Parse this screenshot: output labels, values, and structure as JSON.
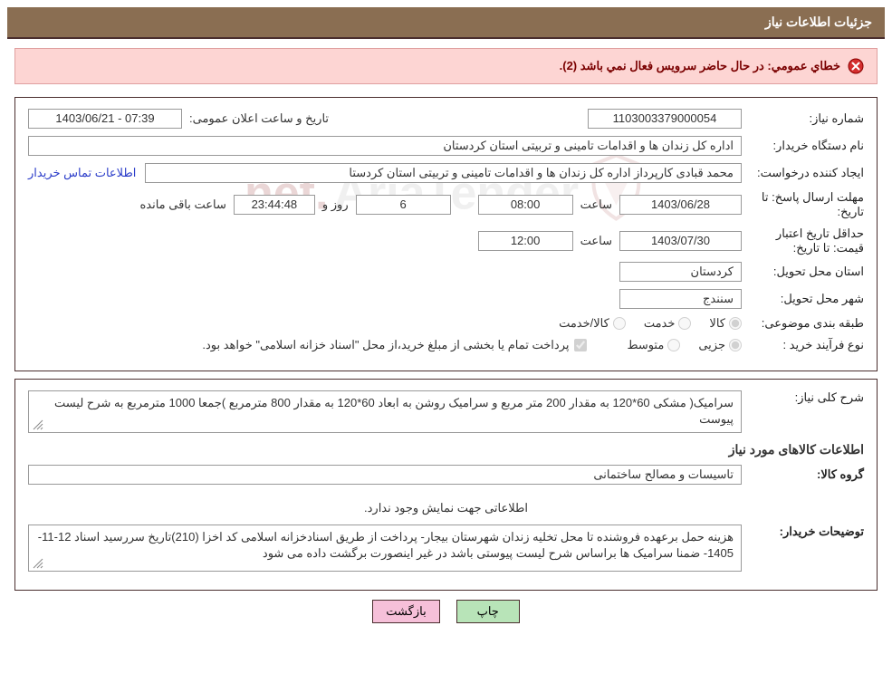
{
  "header": {
    "title": "جزئیات اطلاعات نیاز"
  },
  "error": {
    "message": "خطاي عمومي: در حال حاضر سرويس فعال نمي باشد (2)."
  },
  "fields": {
    "need_number_label": "شماره نیاز:",
    "need_number": "1103003379000054",
    "announce_datetime_label": "تاریخ و ساعت اعلان عمومی:",
    "announce_datetime": "1403/06/21 - 07:39",
    "buyer_org_label": "نام دستگاه خریدار:",
    "buyer_org": "اداره کل زندان ها و اقدامات تامینی و تربیتی استان کردستان",
    "requester_label": "ایجاد کننده درخواست:",
    "requester": "محمد  قبادی کارپرداز اداره کل زندان ها و اقدامات تامینی و تربیتی استان کردستا",
    "buyer_contact_link": "اطلاعات تماس خریدار",
    "response_deadline_label": "مهلت ارسال پاسخ:",
    "to_date_label": "تا تاریخ:",
    "response_date": "1403/06/28",
    "time_label": "ساعت",
    "response_time": "08:00",
    "days": "6",
    "days_and": "روز و",
    "countdown": "23:44:48",
    "remaining": "ساعت باقی مانده",
    "price_valid_label": "حداقل تاریخ اعتبار قیمت:",
    "price_valid_date": "1403/07/30",
    "price_valid_time": "12:00",
    "province_label": "استان محل تحویل:",
    "province": "کردستان",
    "city_label": "شهر محل تحویل:",
    "city": "سنندج",
    "category_label": "طبقه بندی موضوعی:",
    "cat_goods": "کالا",
    "cat_service": "خدمت",
    "cat_goods_service": "کالا/خدمت",
    "process_label": "نوع فرآیند خرید :",
    "proc_small": "جزیی",
    "proc_medium": "متوسط",
    "treasury_note": "پرداخت تمام یا بخشی از مبلغ خرید،از محل \"اسناد خزانه اسلامی\" خواهد بود.",
    "desc_label": "شرح کلی نیاز:",
    "desc_text": "سرامیک( مشکی  60*120  به مقدار 200 متر مربع  و سرامیک روشن به ابعاد 60*120 به مقدار 800 مترمربع )جمعا 1000 مترمربع به شرح لیست پیوست",
    "goods_info_title": "اطلاعات کالاهای مورد نیاز",
    "goods_group_label": "گروه کالا:",
    "goods_group": "تاسیسات و مصالح ساختمانی",
    "empty_info": "اطلاعاتی جهت نمایش وجود ندارد.",
    "buyer_notes_label": "توضیحات خریدار:",
    "buyer_notes": "هزینه حمل برعهده فروشنده  تا محل  تخلیه  زندان  شهرستان بیجار- پرداخت از طریق اسنادخزانه اسلامی کد اخزا (210)تاریخ سررسید اسناد 12-11-1405- ضمنا سرامیک ها براساس شرح لیست پیوستی باشد در غیر اینصورت برگشت داده می شود"
  },
  "buttons": {
    "print": "چاپ",
    "back": "بازگشت"
  },
  "watermark": {
    "brand_part1": "AriaTender",
    "brand_part2": ".net"
  }
}
